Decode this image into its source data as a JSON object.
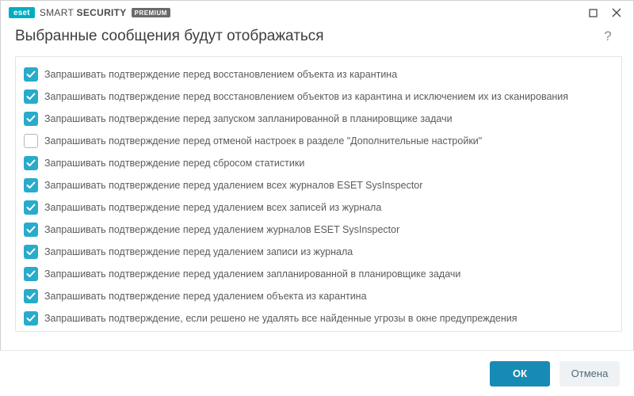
{
  "brand": {
    "badge": "eset",
    "name_light": "SMART ",
    "name_bold": "SECURITY",
    "premium": "PREMIUM"
  },
  "title": "Выбранные сообщения будут отображаться",
  "items": [
    {
      "checked": true,
      "label": "Запрашивать подтверждение перед восстановлением объекта из карантина"
    },
    {
      "checked": true,
      "label": "Запрашивать подтверждение перед восстановлением объектов из карантина и исключением их из сканирования"
    },
    {
      "checked": true,
      "label": "Запрашивать подтверждение перед запуском запланированной в планировщике задачи"
    },
    {
      "checked": false,
      "label": "Запрашивать подтверждение перед отменой настроек в разделе \"Дополнительные настройки\""
    },
    {
      "checked": true,
      "label": "Запрашивать подтверждение перед сбросом статистики"
    },
    {
      "checked": true,
      "label": "Запрашивать подтверждение перед удалением всех журналов ESET SysInspector"
    },
    {
      "checked": true,
      "label": "Запрашивать подтверждение перед удалением всех записей из журнала"
    },
    {
      "checked": true,
      "label": "Запрашивать подтверждение перед удалением журналов ESET SysInspector"
    },
    {
      "checked": true,
      "label": "Запрашивать подтверждение перед удалением записи из журнала"
    },
    {
      "checked": true,
      "label": "Запрашивать подтверждение перед удалением запланированной в планировщике задачи"
    },
    {
      "checked": true,
      "label": "Запрашивать подтверждение перед удалением объекта из карантина"
    },
    {
      "checked": true,
      "label": "Запрашивать подтверждение, если решено не удалять все найденные угрозы в окне предупреждения"
    }
  ],
  "footer": {
    "ok": "ОК",
    "cancel": "Отмена"
  }
}
